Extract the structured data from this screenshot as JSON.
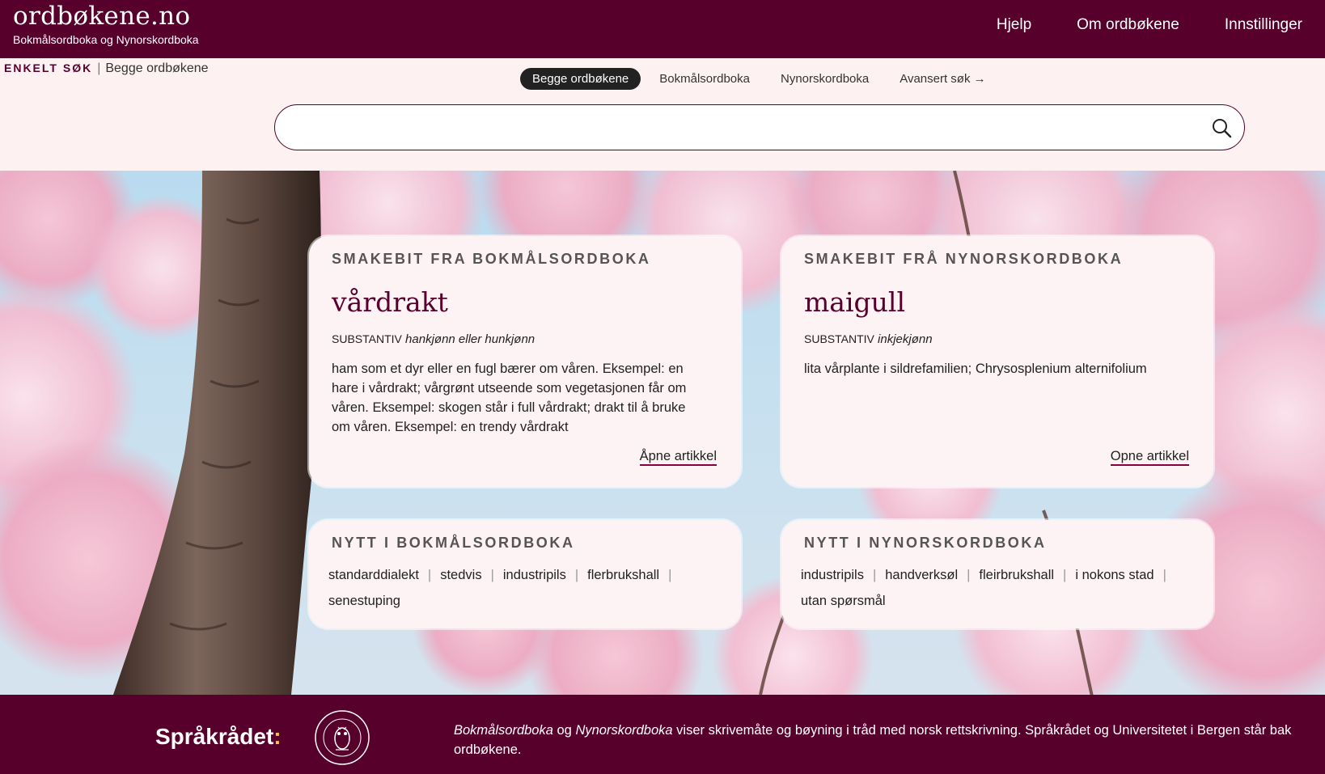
{
  "header": {
    "site_title": "ordbøkene.no",
    "subtitle": "Bokmålsordboka og Nynorskordboka",
    "nav": [
      "Hjelp",
      "Om ordbøkene",
      "Innstillinger"
    ]
  },
  "search": {
    "mode_label": "ENKELT SØK",
    "mode_value": "Begge ordbøkene",
    "scope_tabs": [
      "Begge ordbøkene",
      "Bokmålsordboka",
      "Nynorskordboka",
      "Avansert søk →"
    ],
    "selected_scope": "Begge ordbøkene",
    "query": "",
    "placeholder": "",
    "search_icon": "search-icon"
  },
  "cards": {
    "bm_sample": {
      "heading": "SMAKEBIT FRA BOKMÅLSORDBOKA",
      "word": "vårdrakt",
      "word_class": "SUBSTANTIV",
      "gender": "hankjønn eller hunkjønn",
      "definition": "ham som et dyr eller en fugl bærer om våren. Eksempel: en hare i vårdrakt; vårgrønt utseende som vegetasjonen får om våren. Eksempel: skogen står i full vårdrakt; drakt til å bruke om våren. Eksempel: en trendy vårdrakt",
      "link": "Åpne artikkel"
    },
    "nn_sample": {
      "heading": "SMAKEBIT FRÅ NYNORSKORDBOKA",
      "word": "maigull",
      "word_class": "SUBSTANTIV",
      "gender": "inkjekjønn",
      "definition": "lita vårplante i sildrefamilien; Chrysosplenium alternifolium",
      "link": "Opne artikkel"
    },
    "bm_new": {
      "heading": "NYTT I BOKMÅLSORDBOKA",
      "words": [
        "standarddialekt",
        "stedvis",
        "industripils",
        "flerbrukshall",
        "senestuping"
      ]
    },
    "nn_new": {
      "heading": "NYTT I NYNORSKORDBOKA",
      "words": [
        "industripils",
        "handverksøl",
        "fleirbrukshall",
        "i nokons stad",
        "utan spørsmål"
      ]
    }
  },
  "footer": {
    "org_logo": "Språkrådet",
    "uni_seal_text": "UNIVERSITAS BERGENSIS",
    "text_part1": "Bokmålsordboka",
    "text_og": " og ",
    "text_part2": "Nynorskordboka",
    "text_rest": " viser skrivemåte og bøyning i tråd med norsk rettskrivning. Språkrådet og Universitetet i Bergen står bak ordbøkene."
  },
  "colors": {
    "brand": "#56002b",
    "card_bg": "#fdf3f4",
    "page_bg": "#fdf1f2",
    "accent_yellow": "#f4c542"
  }
}
